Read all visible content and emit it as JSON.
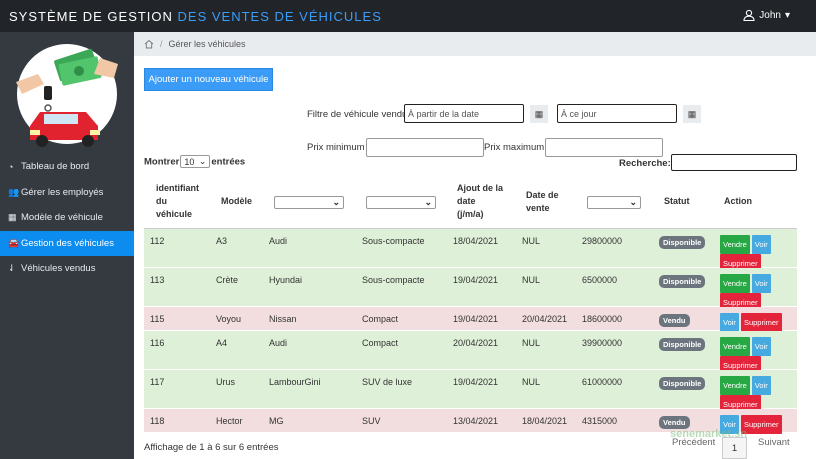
{
  "header": {
    "title_part1": "SYSTÈME DE GESTION ",
    "title_part2": "DES VENTES DE VÉHICULES",
    "user_name": "John",
    "caret": "▾"
  },
  "sidebar": {
    "items": [
      {
        "label": "Tableau de bord",
        "icon": "dashboard-icon",
        "active": false
      },
      {
        "label": "Gérer les employés",
        "icon": "users-icon",
        "active": false
      },
      {
        "label": "Modèle de véhicule",
        "icon": "grid-icon",
        "active": false
      },
      {
        "label": "Gestion des véhicules",
        "icon": "car-icon",
        "active": true
      },
      {
        "label": "Véhicules vendus",
        "icon": "sold-icon",
        "active": false
      }
    ]
  },
  "breadcrumb": {
    "separator": "/",
    "current": "Gérer les véhicules"
  },
  "actions": {
    "add_vehicle": "Ajouter un nouveau véhicule"
  },
  "filters": {
    "date_label": "Filtre de véhicule vendu",
    "from_placeholder": "À partir de la date",
    "to_placeholder": "À ce jour",
    "price_min_label": "Prix minimum :",
    "price_max_label": "Prix maximum :"
  },
  "table_controls": {
    "show_label": "Montrer",
    "show_value": "10",
    "entries_label": "entrées",
    "search_label": "Recherche:"
  },
  "columns": {
    "id_line1": "identifiant",
    "id_line2": "du",
    "id_line3": "véhicule",
    "model": "Modèle",
    "added_line1": "Ajout de la",
    "added_line2": "date",
    "added_line3": "(j/m/a)",
    "sale_line1": "Date de",
    "sale_line2": "vente",
    "status": "Statut",
    "action": "Action"
  },
  "rows": [
    {
      "id": "112",
      "model": "A3",
      "brand": "Audi",
      "category": "Sous-compacte",
      "added": "18/04/2021",
      "sold": "NUL",
      "price": "29800000",
      "status": "Disponible",
      "available": true
    },
    {
      "id": "113",
      "model": "Crète",
      "brand": "Hyundai",
      "category": "Sous-compacte",
      "added": "19/04/2021",
      "sold": "NUL",
      "price": "6500000",
      "status": "Disponible",
      "available": true
    },
    {
      "id": "115",
      "model": "Voyou",
      "brand": "Nissan",
      "category": "Compact",
      "added": "19/04/2021",
      "sold": "20/04/2021",
      "price": "18600000",
      "status": "Vendu",
      "available": false
    },
    {
      "id": "116",
      "model": "A4",
      "brand": "Audi",
      "category": "Compact",
      "added": "20/04/2021",
      "sold": "NUL",
      "price": "39900000",
      "status": "Disponible",
      "available": true
    },
    {
      "id": "117",
      "model": "Urus",
      "brand": "LambourGini",
      "category": "SUV de luxe",
      "added": "19/04/2021",
      "sold": "NUL",
      "price": "61000000",
      "status": "Disponible",
      "available": true
    },
    {
      "id": "118",
      "model": "Hector",
      "brand": "MG",
      "category": "SUV",
      "added": "13/04/2021",
      "sold": "18/04/2021",
      "price": "4315000",
      "status": "Vendu",
      "available": false
    }
  ],
  "row_buttons": {
    "sell": "Vendre",
    "view": "Voir",
    "delete": "Supprimer"
  },
  "footer": {
    "info": "Affichage de 1 à 6 sur 6 entrées",
    "prev": "Précédent",
    "page": "1",
    "next": "Suivant"
  },
  "watermark": "senemarket.sn",
  "colors": {
    "accent": "#3b9cf7",
    "available_row": "#dff0d8",
    "sold_row": "#f2dede",
    "topbar": "#212529",
    "sidebar": "#343a40"
  }
}
